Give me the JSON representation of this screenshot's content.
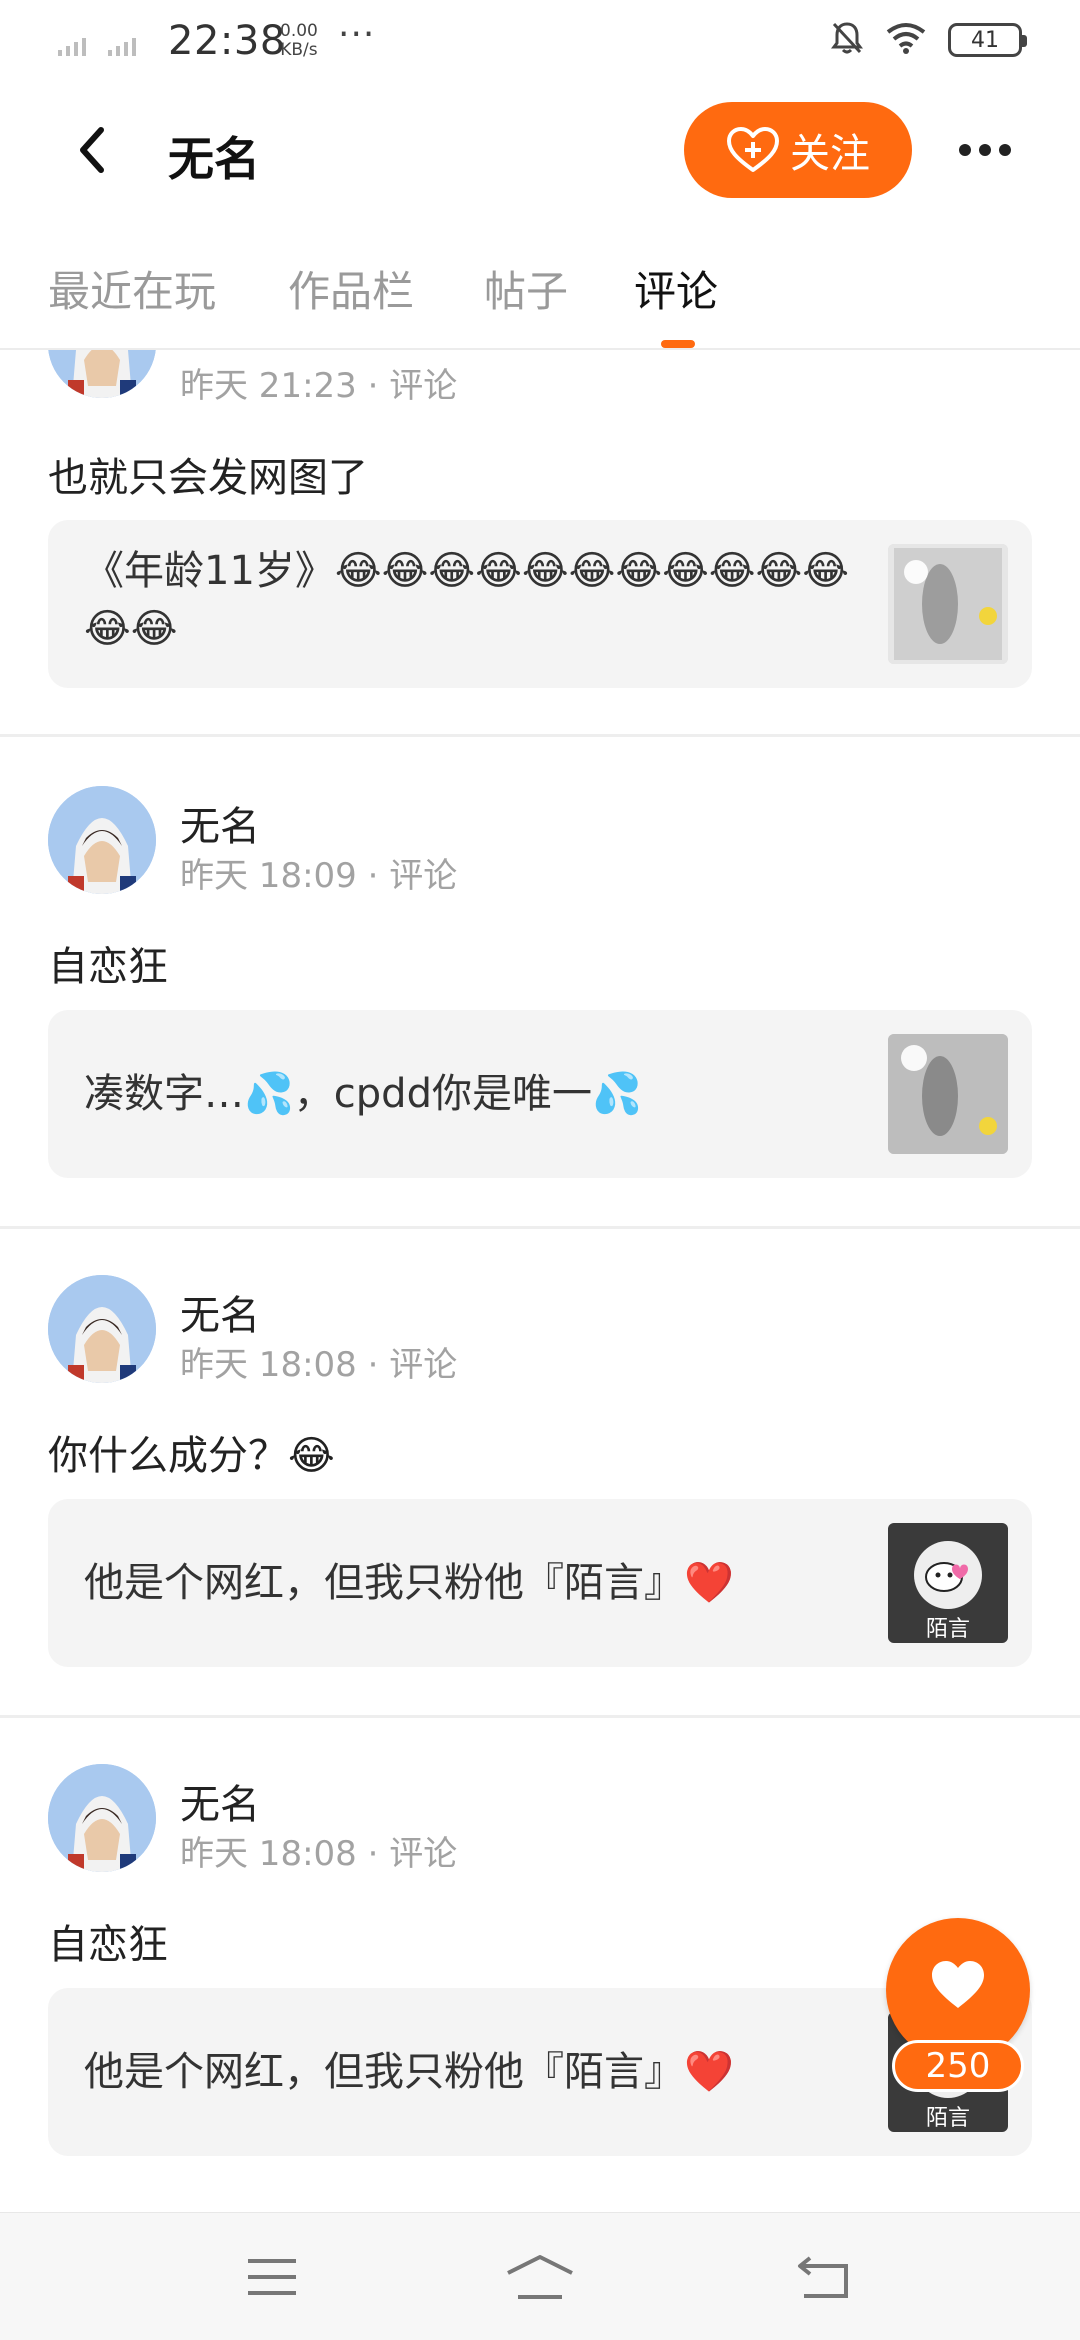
{
  "status_bar": {
    "time": "22:38",
    "speed_value": "0.00",
    "speed_unit": "KB/s",
    "battery": "41"
  },
  "header": {
    "title": "无名",
    "follow_label": "关注"
  },
  "tabs": [
    "最近在玩",
    "作品栏",
    "帖子",
    "评论"
  ],
  "active_tab": "评论",
  "posts": [
    {
      "author": "",
      "meta": "昨天 21:23 · 评论",
      "text": "也就只会发网图了",
      "quote_text": "《年龄11岁》😂😂😂😂😂😂😂😂😂😂😂😂😂"
    },
    {
      "author": "无名",
      "meta": "昨天 18:09 · 评论",
      "text": "自恋狂",
      "quote_text": "凑数字…💦，cpdd你是唯一💦"
    },
    {
      "author": "无名",
      "meta": "昨天 18:08 · 评论",
      "text": "你什么成分？😂",
      "quote_text": "他是个网红，但我只粉他『陌言』❤️"
    },
    {
      "author": "无名",
      "meta": "昨天 18:08 · 评论",
      "text": "自恋狂",
      "quote_text": "他是个网红，但我只粉他『陌言』❤️"
    }
  ],
  "thumbnail_caption": "陌言",
  "like": {
    "count": "250"
  },
  "colors": {
    "accent": "#ff6a10",
    "muted_text": "#a2a2a2",
    "card_bg": "#f4f4f4"
  }
}
